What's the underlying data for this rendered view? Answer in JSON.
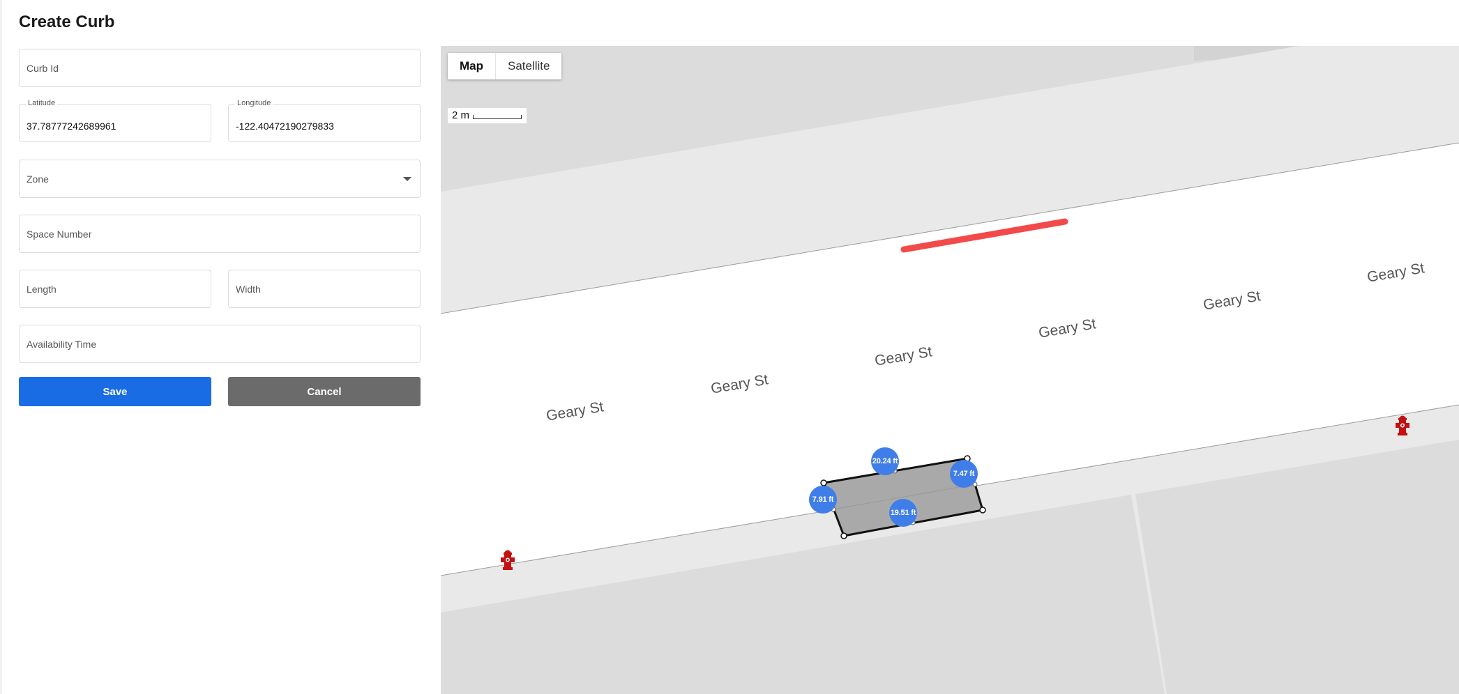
{
  "page": {
    "title": "Create Curb"
  },
  "form": {
    "curb_id": {
      "placeholder": "Curb Id",
      "value": ""
    },
    "latitude": {
      "label": "Latitude",
      "value": "37.78777242689961"
    },
    "longitude": {
      "label": "Longitude",
      "value": "-122.40472190279833"
    },
    "zone": {
      "placeholder": "Zone",
      "value": ""
    },
    "space_number": {
      "placeholder": "Space Number",
      "value": ""
    },
    "length": {
      "placeholder": "Length",
      "value": ""
    },
    "width": {
      "placeholder": "Width",
      "value": ""
    },
    "availability_time": {
      "placeholder": "Availability Time",
      "value": ""
    },
    "save_label": "Save",
    "cancel_label": "Cancel"
  },
  "map": {
    "type_controls": {
      "map_label": "Map",
      "satellite_label": "Satellite",
      "active": "Map"
    },
    "scale_label": "2 m",
    "street_name": "Geary St",
    "street_labels": [
      "Geary St",
      "Geary St",
      "Geary St",
      "Geary St",
      "Geary St",
      "Geary St"
    ],
    "measurements": {
      "top": "20.24 ft",
      "right": "7.47 ft",
      "left": "7.91 ft",
      "bottom": "19.51 ft"
    },
    "colors": {
      "red_curb": "#f24a4a",
      "measure_badge": "#3f7ee8",
      "block": "#dcdcdc",
      "sidewalk": "#e9e9e9",
      "polygon": "#a9a9a9",
      "hydrant": "#c41010"
    },
    "icons": [
      "fire-hydrant-icon",
      "fire-hydrant-icon"
    ]
  }
}
